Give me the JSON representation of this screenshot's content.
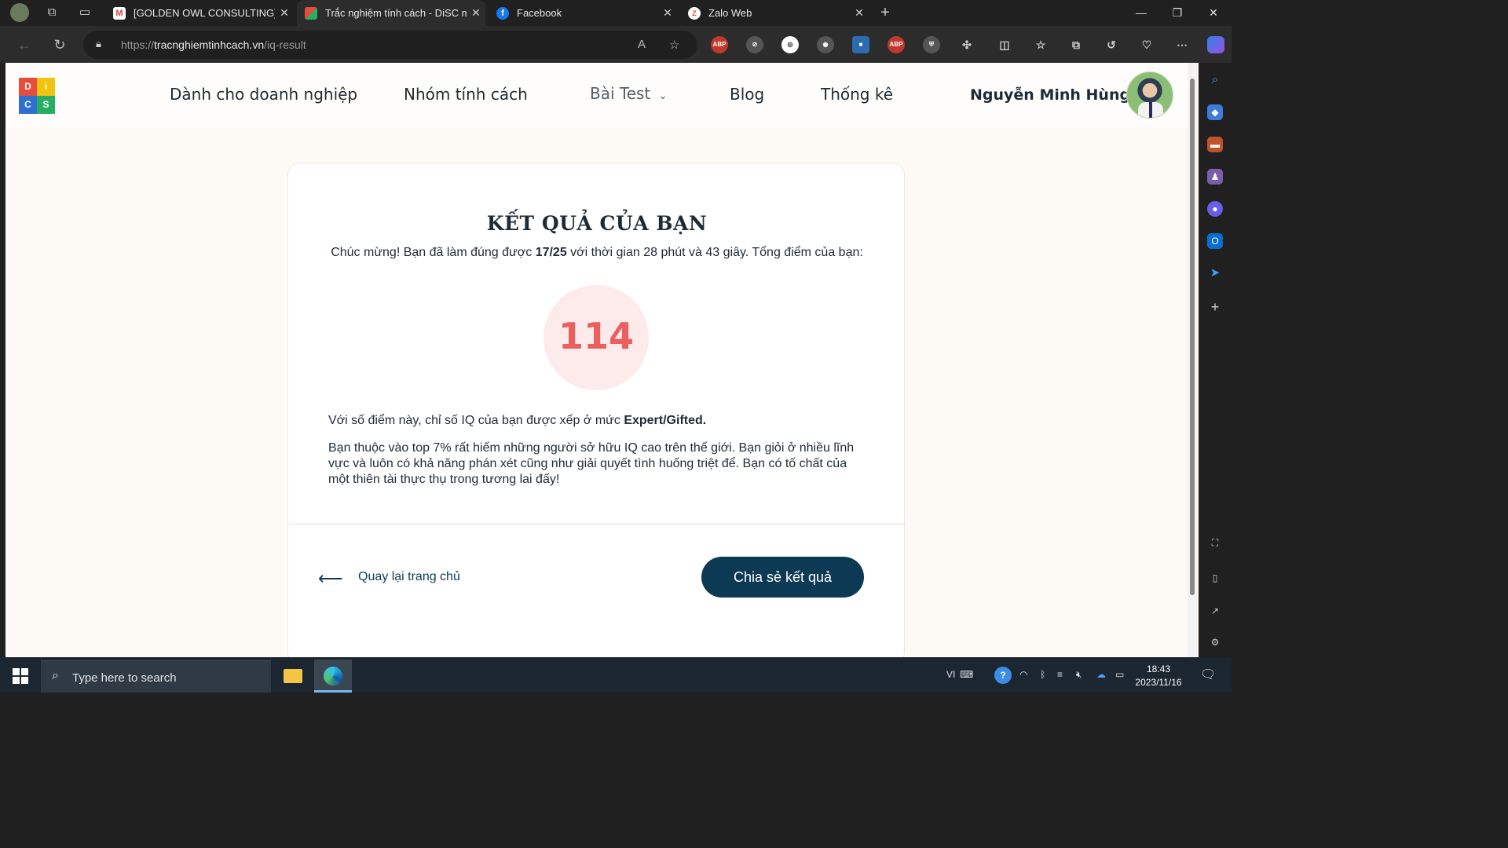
{
  "browser": {
    "tabs": [
      {
        "label": "[GOLDEN OWL CONSULTING] - A",
        "icon": "gmail-icon",
        "active": false
      },
      {
        "label": "Trắc nghiệm tính cách - DiSC mi",
        "icon": "disc-favicon",
        "active": true
      },
      {
        "label": "Facebook",
        "icon": "facebook-icon",
        "active": false
      },
      {
        "label": "Zalo Web",
        "icon": "zalo-icon",
        "active": false
      }
    ],
    "url_prefix": "https://",
    "url_domain": "tracnghiemtinhcach.vn",
    "url_path": "/iq-result"
  },
  "site": {
    "nav": [
      "Dành cho doanh nghiệp",
      "Nhóm tính cách",
      "Bài Test",
      "Blog",
      "Thống kê"
    ],
    "user_name": "Nguyễn Minh Hùng",
    "logo_letters": [
      "D",
      "i",
      "S",
      "C"
    ]
  },
  "result": {
    "title": "KẾT QUẢ CỦA BẠN",
    "summary_pre": "Chúc mừng! Bạn đã làm đúng được ",
    "summary_score": "17/25",
    "summary_post": " với thời gian 28 phút và 43 giây. Tổng điểm của bạn:",
    "score": "114",
    "level_pre": "Với số điểm này, chỉ số IQ của bạn được xếp ở mức ",
    "level": "Expert/Gifted.",
    "description": "Bạn thuộc vào top 7% rất hiếm những người sở hữu IQ cao trên thế giới. Bạn giỏi ở nhiều lĩnh vực và luôn có khả năng phán xét cũng như giải quyết tình huống triệt để. Bạn có tố chất của một thiên tài thực thụ trong tương lai đấy!",
    "back_label": "Quay lại trang chủ",
    "share_label": "Chia sẻ kết quả"
  },
  "taskbar": {
    "search_placeholder": "Type here to search",
    "lang": "VI",
    "time": "18:43",
    "date": "2023/11/16"
  },
  "colors": {
    "accent": "#0c3a55",
    "score": "#e9605e",
    "score_bg": "#fdeaea"
  }
}
